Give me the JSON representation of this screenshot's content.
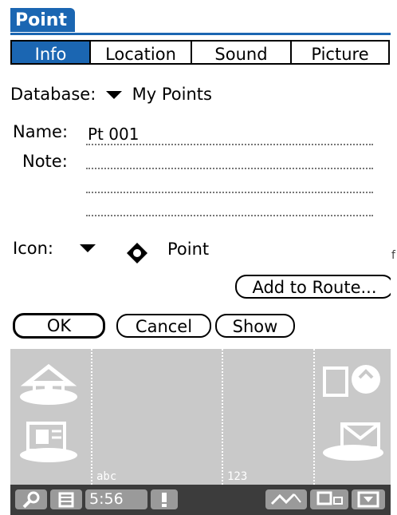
{
  "app": {
    "title": "Point"
  },
  "tabs": [
    {
      "label": "Info",
      "active": true
    },
    {
      "label": "Location",
      "active": false
    },
    {
      "label": "Sound",
      "active": false
    },
    {
      "label": "Picture",
      "active": false
    }
  ],
  "form": {
    "database_label": "Database:",
    "database_value": "My Points",
    "name_label": "Name:",
    "name_value": "Pt 001",
    "note_label": "Note:",
    "icon_label": "Icon:",
    "icon_value": "Point"
  },
  "buttons": {
    "add_to_route": "Add to Route...",
    "ok": "OK",
    "cancel": "Cancel",
    "show": "Show"
  },
  "silkscreen": {
    "abc_label": "abc",
    "num_label": "123"
  },
  "statusbar": {
    "time": "5:56"
  },
  "edge_mark": "f",
  "colors": {
    "accent": "#1b66b2",
    "silkscreen": "#c9c9c9",
    "statusbar": "#3c3c3c"
  }
}
